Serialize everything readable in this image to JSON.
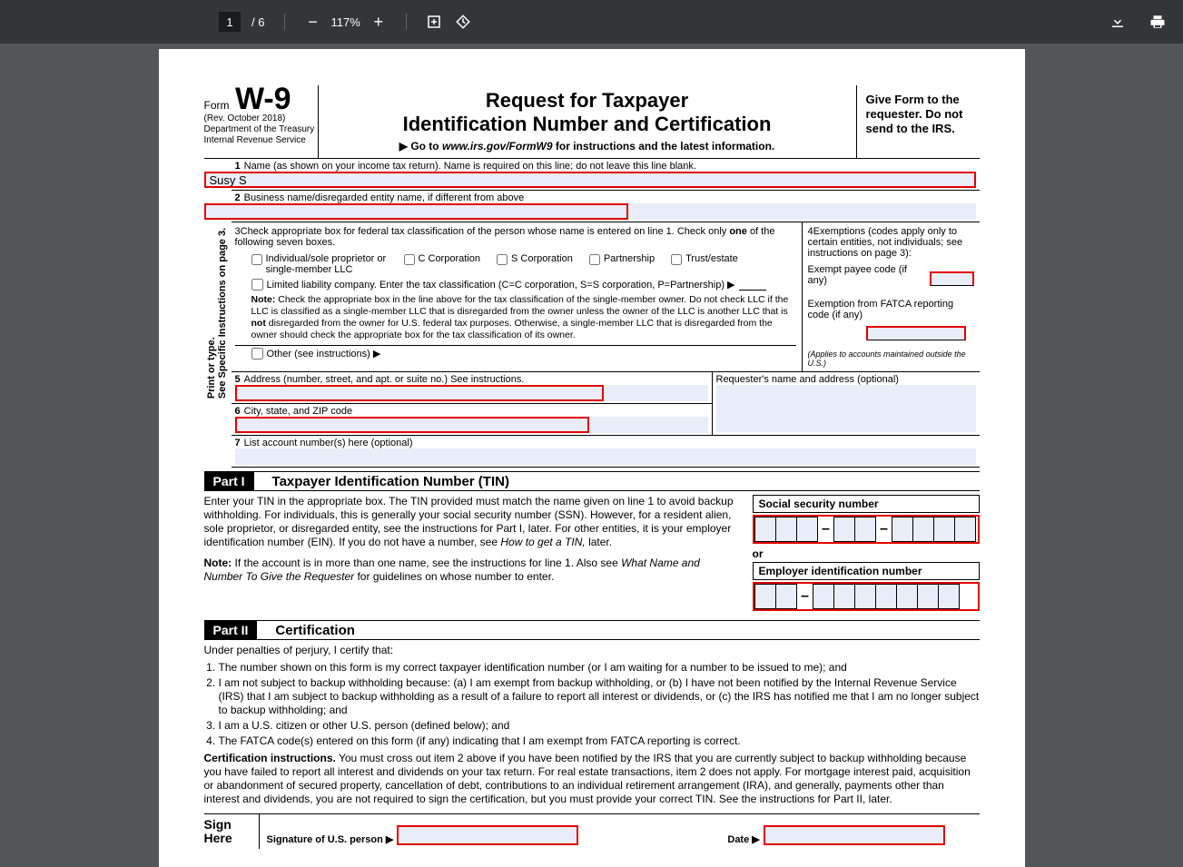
{
  "toolbar": {
    "current_page": "1",
    "total_pages": "6",
    "zoom": "117%"
  },
  "header": {
    "form_word": "Form",
    "form_code": "W-9",
    "rev": "(Rev. October 2018)",
    "dept": "Department of the Treasury",
    "irs": "Internal Revenue Service",
    "title1": "Request for Taxpayer",
    "title2": "Identification Number and Certification",
    "goto_prefix": "▶ Go to ",
    "goto_url": "www.irs.gov/FormW9",
    "goto_suffix": " for instructions and the latest information.",
    "give": "Give Form to the requester. Do not send to the IRS."
  },
  "vert": "Print or type.",
  "vert2": "See Specific Instructions on page 3.",
  "lines": {
    "l1": "Name (as shown on your income tax return). Name is required on this line; do not leave this line blank.",
    "l1_val": "Susy S",
    "l2": "Business name/disregarded entity name, if different from above",
    "l2_val": "",
    "l3a": "Check appropriate box for federal tax classification of the person whose name is entered on line 1. Check only ",
    "l3b": "one",
    "l3c": " of the following seven boxes.",
    "cb1": "Individual/sole proprietor or single-member LLC",
    "cb2": "C Corporation",
    "cb3": "S Corporation",
    "cb4": "Partnership",
    "cb5": "Trust/estate",
    "llc": "Limited liability company. Enter the tax classification (C=C corporation, S=S corporation, P=Partnership) ▶",
    "note_b": "Note:",
    "note": " Check the appropriate box in the line above for the tax classification of the single-member owner. Do not check LLC if the LLC is classified as a single-member LLC that is disregarded from the owner unless the owner of the LLC is another LLC that is ",
    "note_not": "not",
    "note2": " disregarded from the owner for U.S. federal tax purposes. Otherwise, a single-member LLC that is disregarded from the owner should check the appropriate box for the tax classification of its owner.",
    "other": "Other (see instructions) ▶",
    "l4a": "Exemptions (codes apply only to certain entities, not individuals; see instructions on page 3):",
    "l4b": "Exempt payee code (if any)",
    "l4c": "Exemption from FATCA reporting code (if any)",
    "l4d": "(Applies to accounts maintained outside the U.S.)",
    "l5": "Address (number, street, and apt. or suite no.) See instructions.",
    "req": "Requester's name and address (optional)",
    "l6": "City, state, and ZIP code",
    "l7": "List account number(s) here (optional)"
  },
  "part1": {
    "label": "Part I",
    "title": "Taxpayer Identification Number (TIN)",
    "p1a": "Enter your TIN in the appropriate box. The TIN provided must match the name given on line 1 to avoid backup withholding. For individuals, this is generally your social security number (SSN). However, for a resident alien, sole proprietor, or disregarded entity, see the instructions for Part I, later. For other entities, it is your employer identification number (EIN). If you do not have a number, see ",
    "p1b": "How to get a TIN,",
    "p1c": " later.",
    "p2a": "Note:",
    "p2b": " If the account is in more than one name, see the instructions for line 1. Also see ",
    "p2c": "What Name and Number To Give the Requester",
    "p2d": " for guidelines on whose number to enter.",
    "ssn": "Social security number",
    "or": "or",
    "ein": "Employer identification number"
  },
  "part2": {
    "label": "Part II",
    "title": "Certification",
    "intro": "Under penalties of perjury, I certify that:",
    "i1": "The number shown on this form is my correct taxpayer identification number (or I am waiting for a number to be issued to me); and",
    "i2": "I am not subject to backup withholding because: (a) I am exempt from backup withholding, or (b) I have not been notified by the Internal Revenue Service (IRS) that I am subject to backup withholding as a result of a failure to report all interest or dividends, or (c) the IRS has notified me that I am no longer subject to backup withholding; and",
    "i3": "I am a U.S. citizen or other U.S. person (defined below); and",
    "i4": "The FATCA code(s) entered on this form (if any) indicating that I am exempt from FATCA reporting is correct.",
    "ci_b": "Certification instructions.",
    "ci": " You must cross out item 2 above if you have been notified by the IRS that you are currently subject to backup withholding because you have failed to report all interest and dividends on your tax return. For real estate transactions, item 2 does not apply. For mortgage interest paid, acquisition or abandonment of secured property, cancellation of debt, contributions to an individual retirement arrangement (IRA), and generally, payments other than interest and dividends, you are not required to sign the certification, but you must provide your correct TIN. See the instructions for Part II, later."
  },
  "sign": {
    "here": "Sign Here",
    "sig": "Signature of U.S. person ▶",
    "date": "Date ▶"
  }
}
